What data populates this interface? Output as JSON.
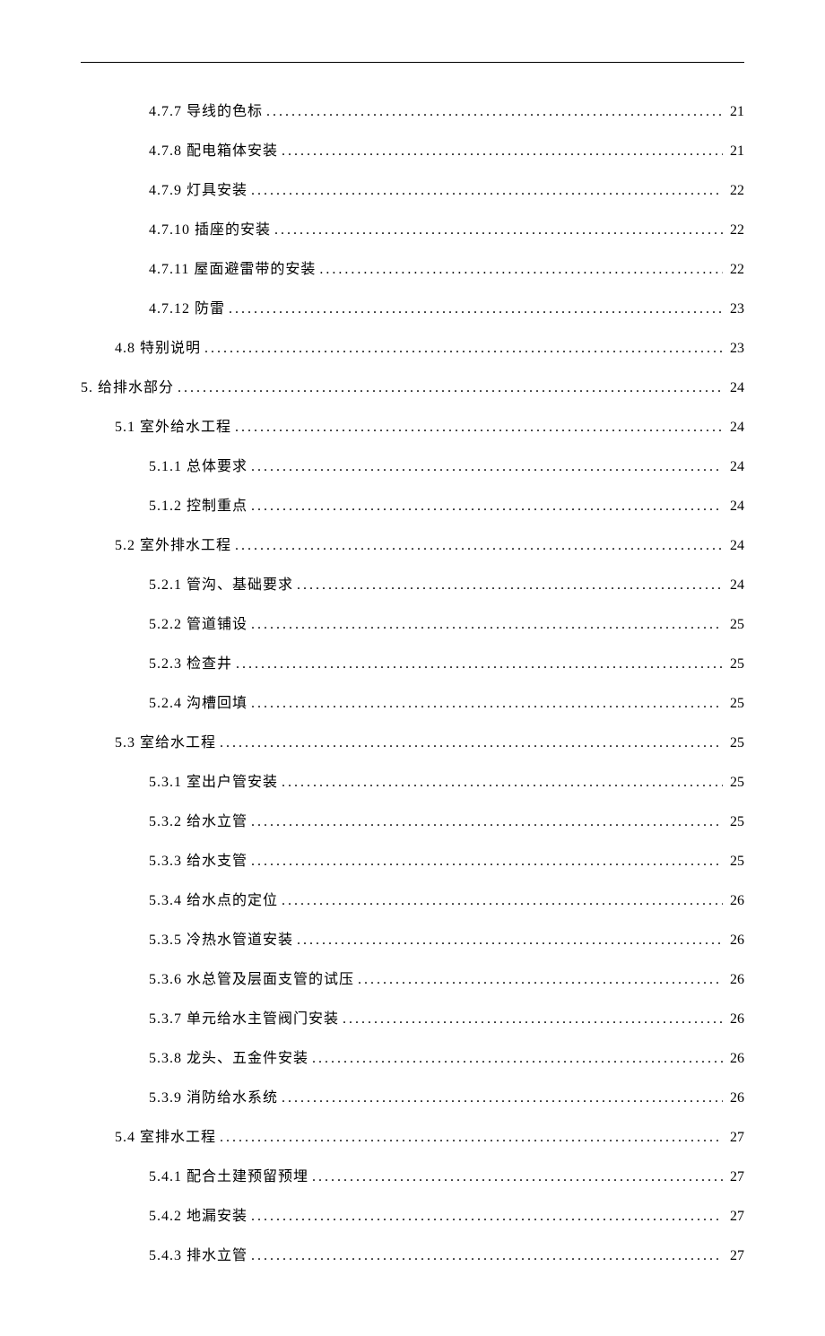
{
  "toc": [
    {
      "level": 3,
      "label": "4.7.7 导线的色标",
      "page": "21"
    },
    {
      "level": 3,
      "label": "4.7.8 配电箱体安装",
      "page": "21"
    },
    {
      "level": 3,
      "label": "4.7.9 灯具安装",
      "page": "22"
    },
    {
      "level": 3,
      "label": "4.7.10 插座的安装",
      "page": "22"
    },
    {
      "level": 3,
      "label": "4.7.11 屋面避雷带的安装",
      "page": "22"
    },
    {
      "level": 3,
      "label": "4.7.12 防雷",
      "page": "23"
    },
    {
      "level": 2,
      "label": "4.8 特别说明",
      "page": "23"
    },
    {
      "level": 1,
      "label": "5. 给排水部分",
      "page": "24"
    },
    {
      "level": 2,
      "label": "5.1 室外给水工程",
      "page": "24"
    },
    {
      "level": 3,
      "label": "5.1.1 总体要求",
      "page": "24"
    },
    {
      "level": 3,
      "label": "5.1.2 控制重点",
      "page": "24"
    },
    {
      "level": 2,
      "label": "5.2 室外排水工程",
      "page": "24"
    },
    {
      "level": 3,
      "label": "5.2.1 管沟、基础要求",
      "page": "24"
    },
    {
      "level": 3,
      "label": "5.2.2 管道铺设",
      "page": "25"
    },
    {
      "level": 3,
      "label": "5.2.3 检查井",
      "page": "25"
    },
    {
      "level": 3,
      "label": "5.2.4 沟槽回填",
      "page": "25"
    },
    {
      "level": 2,
      "label": "5.3 室给水工程",
      "page": "25"
    },
    {
      "level": 3,
      "label": "5.3.1 室出户管安装",
      "page": "25"
    },
    {
      "level": 3,
      "label": "5.3.2 给水立管",
      "page": "25"
    },
    {
      "level": 3,
      "label": "5.3.3 给水支管",
      "page": "25"
    },
    {
      "level": 3,
      "label": "5.3.4 给水点的定位",
      "page": "26"
    },
    {
      "level": 3,
      "label": "5.3.5 冷热水管道安装",
      "page": "26"
    },
    {
      "level": 3,
      "label": "5.3.6 水总管及层面支管的试压",
      "page": "26"
    },
    {
      "level": 3,
      "label": "5.3.7 单元给水主管阀门安装",
      "page": "26"
    },
    {
      "level": 3,
      "label": "5.3.8 龙头、五金件安装",
      "page": "26"
    },
    {
      "level": 3,
      "label": "5.3.9 消防给水系统",
      "page": "26"
    },
    {
      "level": 2,
      "label": "5.4 室排水工程",
      "page": "27"
    },
    {
      "level": 3,
      "label": "5.4.1 配合土建预留预埋",
      "page": "27"
    },
    {
      "level": 3,
      "label": "5.4.2 地漏安装",
      "page": "27"
    },
    {
      "level": 3,
      "label": "5.4.3 排水立管",
      "page": "27"
    }
  ]
}
